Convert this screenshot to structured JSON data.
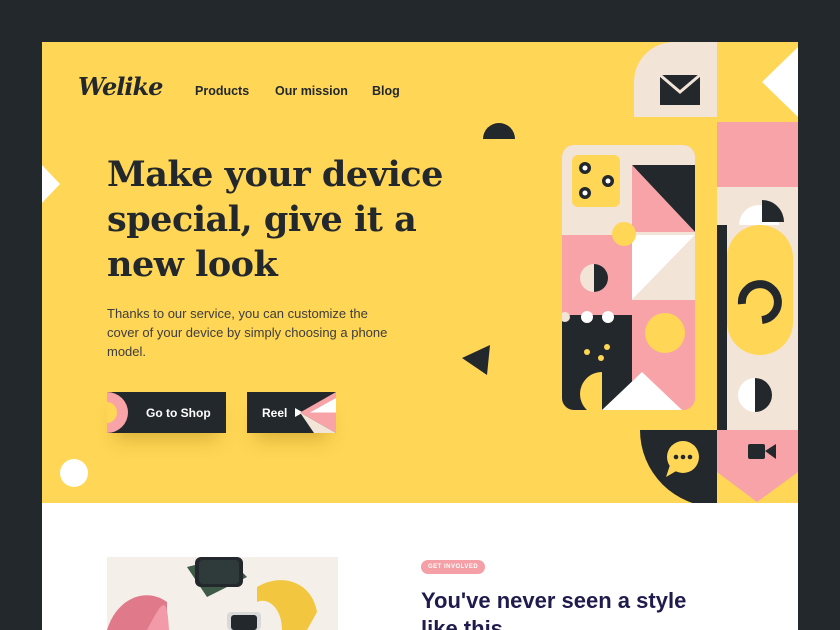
{
  "brand": {
    "logo_text": "Welike"
  },
  "nav": {
    "items": [
      "Products",
      "Our mission",
      "Blog"
    ]
  },
  "hero": {
    "headline": "Make your device special, give it a new look",
    "description": "Thanks to our service, you can customize the cover of your device by simply choosing a phone model.",
    "primary_button": "Go to Shop",
    "secondary_button": "Reel"
  },
  "section": {
    "pill": "GET INVOLVED",
    "title": "You've never seen a style like this"
  },
  "colors": {
    "background": "#23282c",
    "yellow": "#ffd655",
    "pink": "#f7a3a8",
    "cream": "#f2e4d6",
    "dark": "#23282c",
    "navy": "#1f1b4d"
  },
  "icons": [
    "mail-icon",
    "chat-bubble-icon",
    "video-camera-icon",
    "play-icon"
  ]
}
